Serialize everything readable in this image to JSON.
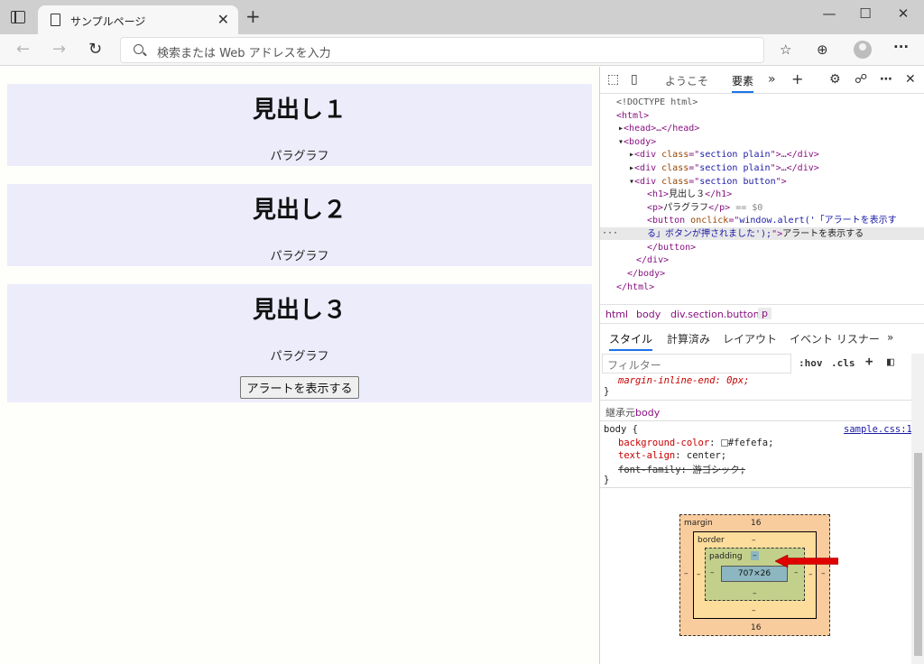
{
  "browser": {
    "tab_title": "サンプルページ",
    "address_placeholder": "検索または Web アドレスを入力"
  },
  "page": {
    "sections": [
      {
        "heading": "見出し１",
        "paragraph": "パラグラフ"
      },
      {
        "heading": "見出し２",
        "paragraph": "パラグラフ"
      },
      {
        "heading": "見出し３",
        "paragraph": "パラグラフ",
        "button": "アラートを表示する"
      }
    ]
  },
  "devtools": {
    "tabs": [
      "ようこそ",
      "要素"
    ],
    "dom": {
      "doctype": "<!DOCTYPE html>",
      "html_open": "<html>",
      "head": "<head>…</head>",
      "body_open": "<body>",
      "div1_cls": "section plain",
      "div2_cls": "section plain",
      "div3_cls": "section button",
      "h1_text": "見出し３",
      "p_text": "パラグラフ",
      "selected_marker": "== $0",
      "button_onclick_1": "window.alert('「アラートを表示す",
      "button_onclick_2": "る」ボタンが押されました');",
      "button_text": "アラートを表示する"
    },
    "breadcrumbs": [
      "html",
      "body",
      "div.section.button",
      "p"
    ],
    "subtabs": [
      "スタイル",
      "計算済み",
      "レイアウト",
      "イベント リスナー"
    ],
    "filter_placeholder": "フィルター",
    "filter_buttons": [
      ":hov",
      ".cls",
      "+"
    ],
    "styles": {
      "cut_rule": "margin-inline-end: 0px;",
      "inherited_label": "継承元",
      "inherited_el": "body",
      "selector": "body {",
      "source": "sample.css:1",
      "props": [
        {
          "name": "background-color",
          "value": "#fefefa;"
        },
        {
          "name": "text-align",
          "value": "center;"
        },
        {
          "name": "font-family",
          "value": "游ゴシック;"
        }
      ]
    },
    "box_model": {
      "margin_label": "margin",
      "margin_top": "16",
      "margin_bottom": "16",
      "border_label": "border",
      "padding_label": "padding",
      "content_size": "707×26",
      "dash": "–"
    }
  }
}
